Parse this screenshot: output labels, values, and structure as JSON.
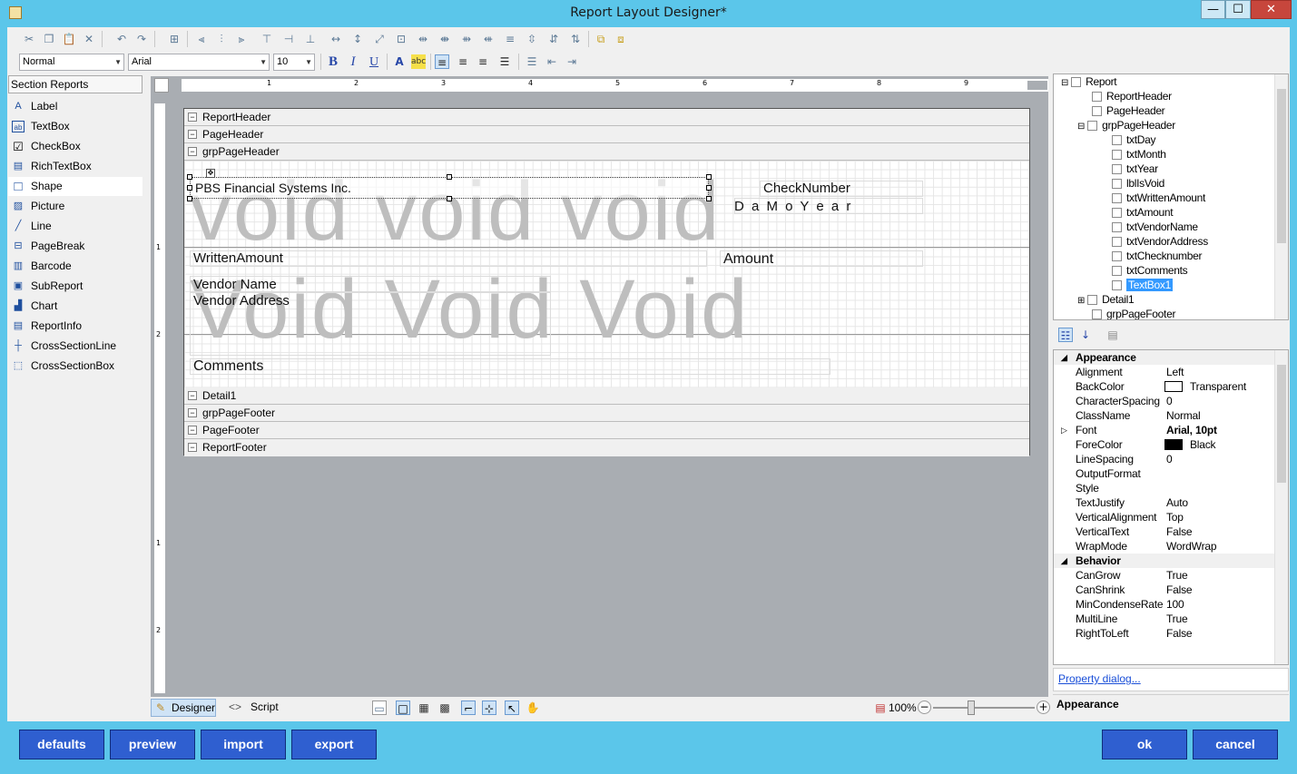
{
  "window": {
    "title": "Report Layout Designer*",
    "min": "—",
    "max": "☐",
    "close": "✕"
  },
  "toolbar": {
    "style_combo": "Normal",
    "font_combo": "Arial",
    "size_combo": "10",
    "bold": "B",
    "italic": "I",
    "underline": "U"
  },
  "left_panel": {
    "title": "Section Reports",
    "items": [
      {
        "label": "Label",
        "icon": "label-icon",
        "glyph": "A"
      },
      {
        "label": "TextBox",
        "icon": "textbox-icon",
        "glyph": "ab"
      },
      {
        "label": "CheckBox",
        "icon": "checkbox-icon",
        "glyph": "☑"
      },
      {
        "label": "RichTextBox",
        "icon": "richtextbox-icon",
        "glyph": "▤"
      },
      {
        "label": "Shape",
        "icon": "shape-icon",
        "glyph": "□"
      },
      {
        "label": "Picture",
        "icon": "picture-icon",
        "glyph": "▨"
      },
      {
        "label": "Line",
        "icon": "line-icon",
        "glyph": "╱"
      },
      {
        "label": "PageBreak",
        "icon": "pagebreak-icon",
        "glyph": "⊟"
      },
      {
        "label": "Barcode",
        "icon": "barcode-icon",
        "glyph": "▥"
      },
      {
        "label": "SubReport",
        "icon": "subreport-icon",
        "glyph": "▣"
      },
      {
        "label": "Chart",
        "icon": "chart-icon",
        "glyph": "▟"
      },
      {
        "label": "ReportInfo",
        "icon": "reportinfo-icon",
        "glyph": "▤"
      },
      {
        "label": "CrossSectionLine",
        "icon": "crosssectionline-icon",
        "glyph": "┼"
      },
      {
        "label": "CrossSectionBox",
        "icon": "crosssectionbox-icon",
        "glyph": "⬚"
      }
    ]
  },
  "ruler_h": [
    "1",
    "2",
    "3",
    "4",
    "5",
    "6",
    "7",
    "8",
    "9"
  ],
  "ruler_v": [
    "1",
    "2",
    "1",
    "2"
  ],
  "bands": {
    "report_header": "ReportHeader",
    "page_header": "PageHeader",
    "grp_page_header": "grpPageHeader",
    "detail": "Detail1",
    "grp_page_footer": "grpPageFooter",
    "page_footer": "PageFooter",
    "report_footer": "ReportFooter"
  },
  "design": {
    "void1": "void void void",
    "void2": "Void Void Void",
    "company": "PBS Financial Systems Inc.",
    "check_number": "CheckNumber",
    "date_text": "D a M o Y e a r",
    "written_amount": "WrittenAmount",
    "amount": "Amount",
    "vendor_name": "Vendor Name",
    "vendor_address": "Vendor Address",
    "comments": "Comments"
  },
  "bottom_bar": {
    "designer_tab": "Designer",
    "script_tab": "Script",
    "zoom": "100%"
  },
  "tree": [
    {
      "label": "Report",
      "level": 0,
      "expander": "⊟"
    },
    {
      "label": "ReportHeader",
      "level": 1,
      "expander": ""
    },
    {
      "label": "PageHeader",
      "level": 1,
      "expander": ""
    },
    {
      "label": "grpPageHeader",
      "level": 1,
      "expander": "⊟"
    },
    {
      "label": "txtDay",
      "level": 2,
      "expander": ""
    },
    {
      "label": "txtMonth",
      "level": 2,
      "expander": ""
    },
    {
      "label": "txtYear",
      "level": 2,
      "expander": ""
    },
    {
      "label": "lblIsVoid",
      "level": 2,
      "expander": ""
    },
    {
      "label": "txtWrittenAmount",
      "level": 2,
      "expander": ""
    },
    {
      "label": "txtAmount",
      "level": 2,
      "expander": ""
    },
    {
      "label": "txtVendorName",
      "level": 2,
      "expander": ""
    },
    {
      "label": "txtVendorAddress",
      "level": 2,
      "expander": ""
    },
    {
      "label": "txtChecknumber",
      "level": 2,
      "expander": ""
    },
    {
      "label": "txtComments",
      "level": 2,
      "expander": ""
    },
    {
      "label": "TextBox1",
      "level": 2,
      "expander": "",
      "selected": true
    },
    {
      "label": "Detail1",
      "level": 1,
      "expander": "⊞"
    },
    {
      "label": "grpPageFooter",
      "level": 1,
      "expander": ""
    }
  ],
  "properties": [
    {
      "name": "Appearance",
      "value": "",
      "category": true
    },
    {
      "name": "Alignment",
      "value": "Left"
    },
    {
      "name": "BackColor",
      "value": "Transparent",
      "swatch": "#ffffff"
    },
    {
      "name": "CharacterSpacing",
      "value": "0"
    },
    {
      "name": "ClassName",
      "value": "Normal"
    },
    {
      "name": "Font",
      "value": "Arial, 10pt",
      "bold": true,
      "expander": "▷"
    },
    {
      "name": "ForeColor",
      "value": "Black",
      "swatch": "#000000"
    },
    {
      "name": "LineSpacing",
      "value": "0"
    },
    {
      "name": "OutputFormat",
      "value": ""
    },
    {
      "name": "Style",
      "value": ""
    },
    {
      "name": "TextJustify",
      "value": "Auto"
    },
    {
      "name": "VerticalAlignment",
      "value": "Top"
    },
    {
      "name": "VerticalText",
      "value": "False"
    },
    {
      "name": "WrapMode",
      "value": "WordWrap"
    },
    {
      "name": "Behavior",
      "value": "",
      "category": true
    },
    {
      "name": "CanGrow",
      "value": "True"
    },
    {
      "name": "CanShrink",
      "value": "False"
    },
    {
      "name": "MinCondenseRate",
      "value": "100"
    },
    {
      "name": "MultiLine",
      "value": "True"
    },
    {
      "name": "RightToLeft",
      "value": "False"
    }
  ],
  "property_dialog_link": "Property dialog...",
  "description_title": "Appearance",
  "buttons": {
    "defaults": "defaults",
    "preview": "preview",
    "import": "import",
    "export": "export",
    "ok": "ok",
    "cancel": "cancel"
  }
}
